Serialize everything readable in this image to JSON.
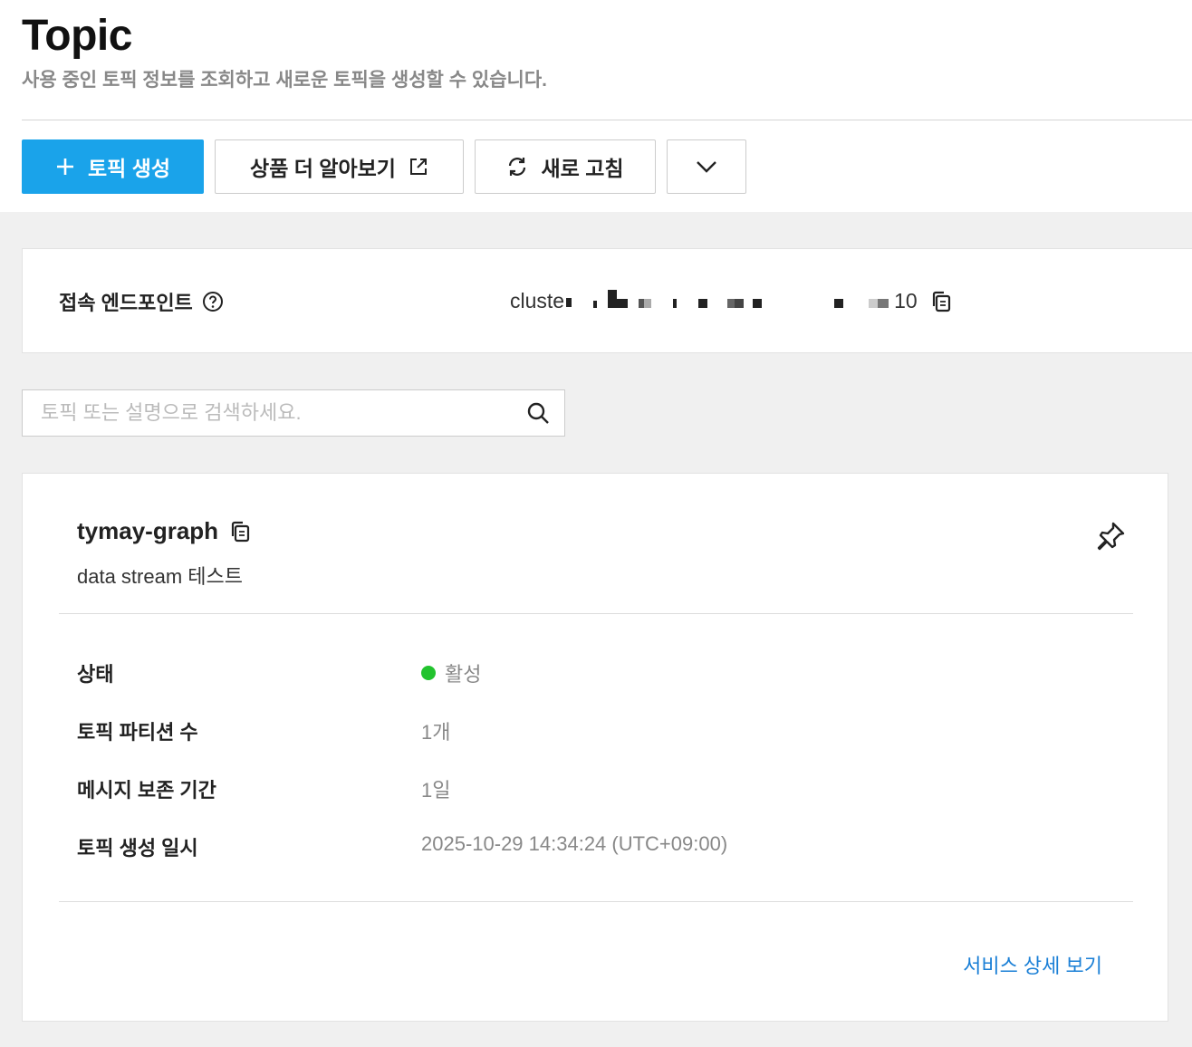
{
  "header": {
    "title": "Topic",
    "subtitle": "사용 중인 토픽 정보를 조회하고 새로운 토픽을 생성할 수 있습니다."
  },
  "toolbar": {
    "create_label": "토픽 생성",
    "learn_label": "상품 더 알아보기",
    "refresh_label": "새로 고침"
  },
  "endpoint": {
    "label": "접속 엔드포인트",
    "value_prefix": "cluste",
    "value_suffix": "10"
  },
  "search": {
    "placeholder": "토픽 또는 설명으로 검색하세요."
  },
  "topic": {
    "name": "tymay-graph",
    "description": "data stream 테스트",
    "rows": [
      {
        "key": "상태",
        "value": "활성"
      },
      {
        "key": "토픽 파티션 수",
        "value": "1개"
      },
      {
        "key": "메시지 보존 기간",
        "value": "1일"
      },
      {
        "key": "토픽 생성 일시",
        "value": "2025-10-29 14:34:24 (UTC+09:00)"
      }
    ],
    "detail_link": "서비스 상세 보기"
  },
  "colors": {
    "primary": "#1aa3ea",
    "status_active": "#22c32e",
    "link": "#1a7fd6"
  }
}
